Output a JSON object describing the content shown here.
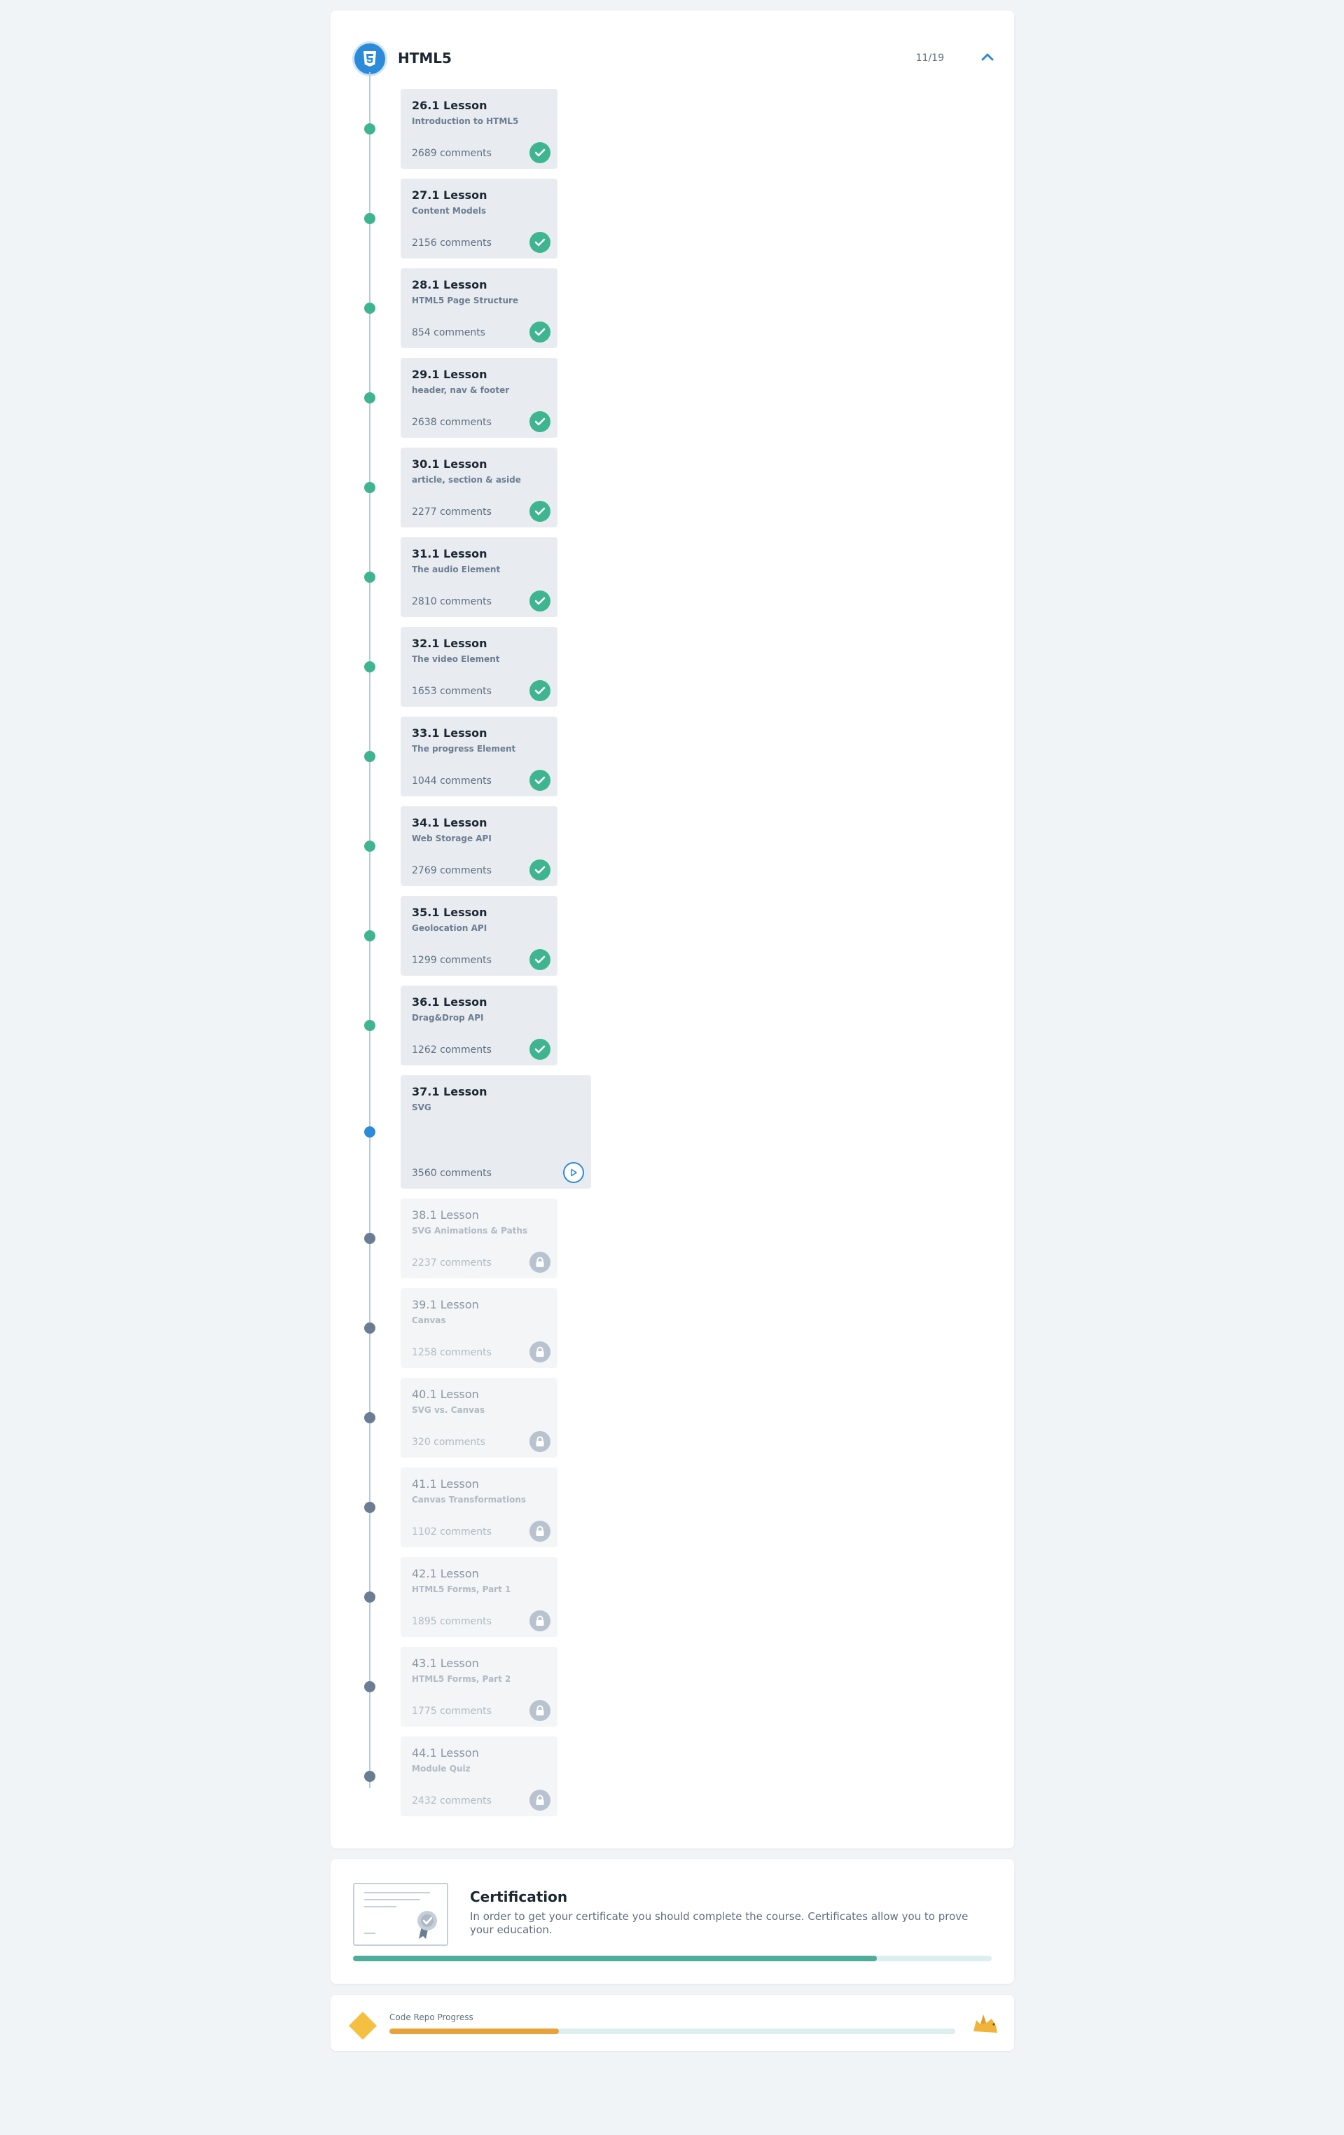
{
  "module": {
    "title": "HTML5",
    "progress_text": "11/19",
    "icon": "html5-shield-icon"
  },
  "lessons": [
    {
      "title": "26.1 Lesson",
      "subtitle": "Introduction to HTML5",
      "comments": "2689 comments",
      "state": "done"
    },
    {
      "title": "27.1 Lesson",
      "subtitle": "Content Models",
      "comments": "2156 comments",
      "state": "done"
    },
    {
      "title": "28.1 Lesson",
      "subtitle": "HTML5 Page Structure",
      "comments": "854 comments",
      "state": "done"
    },
    {
      "title": "29.1 Lesson",
      "subtitle": "header, nav & footer",
      "comments": "2638 comments",
      "state": "done"
    },
    {
      "title": "30.1 Lesson",
      "subtitle": "article, section & aside",
      "comments": "2277 comments",
      "state": "done"
    },
    {
      "title": "31.1 Lesson",
      "subtitle": "The audio Element",
      "comments": "2810 comments",
      "state": "done"
    },
    {
      "title": "32.1 Lesson",
      "subtitle": "The video Element",
      "comments": "1653 comments",
      "state": "done"
    },
    {
      "title": "33.1 Lesson",
      "subtitle": "The progress Element",
      "comments": "1044 comments",
      "state": "done"
    },
    {
      "title": "34.1 Lesson",
      "subtitle": "Web Storage API",
      "comments": "2769 comments",
      "state": "done"
    },
    {
      "title": "35.1 Lesson",
      "subtitle": "Geolocation API",
      "comments": "1299 comments",
      "state": "done"
    },
    {
      "title": "36.1 Lesson",
      "subtitle": "Drag&Drop API",
      "comments": "1262 comments",
      "state": "done"
    },
    {
      "title": "37.1 Lesson",
      "subtitle": "SVG",
      "comments": "3560 comments",
      "state": "current"
    },
    {
      "title": "38.1 Lesson",
      "subtitle": "SVG Animations & Paths",
      "comments": "2237 comments",
      "state": "locked"
    },
    {
      "title": "39.1 Lesson",
      "subtitle": "Canvas",
      "comments": "1258 comments",
      "state": "locked"
    },
    {
      "title": "40.1 Lesson",
      "subtitle": "SVG vs. Canvas",
      "comments": "320 comments",
      "state": "locked"
    },
    {
      "title": "41.1 Lesson",
      "subtitle": "Canvas Transformations",
      "comments": "1102 comments",
      "state": "locked"
    },
    {
      "title": "42.1 Lesson",
      "subtitle": "HTML5 Forms, Part 1",
      "comments": "1895 comments",
      "state": "locked"
    },
    {
      "title": "43.1 Lesson",
      "subtitle": "HTML5 Forms, Part 2",
      "comments": "1775 comments",
      "state": "locked"
    },
    {
      "title": "44.1 Lesson",
      "subtitle": "Module Quiz",
      "comments": "2432 comments",
      "state": "locked"
    }
  ],
  "certification": {
    "title": "Certification",
    "description": "In order to get your certificate you should complete the course. Certificates allow you to prove your education.",
    "progress": 0.82
  },
  "code_repo": {
    "label": "Code Repo Progress",
    "progress": 0.3
  },
  "colors": {
    "done": "#3fb58f",
    "current": "#2b8bd9",
    "locked": "#6b7d92",
    "cert_bar": "#4fae9b",
    "repo_bar": "#e8a23a"
  }
}
